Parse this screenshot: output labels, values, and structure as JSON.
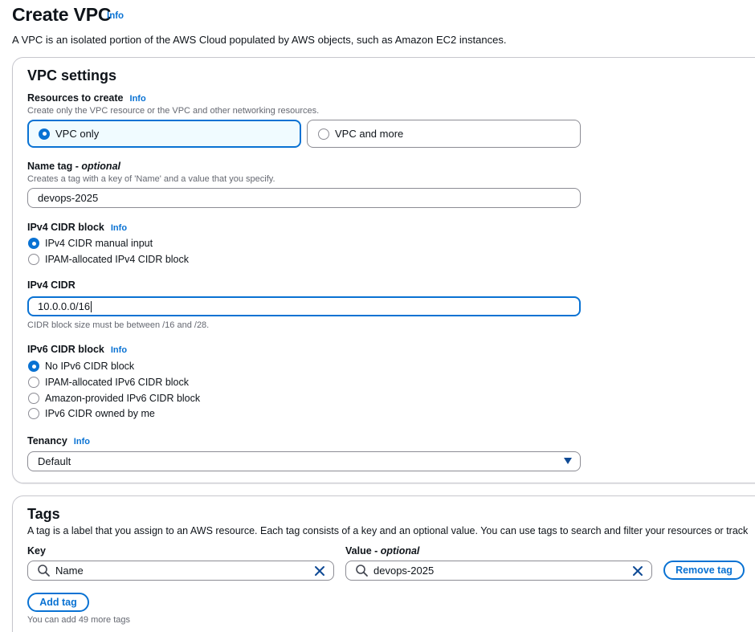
{
  "page": {
    "title": "Create VPC",
    "info": "Info",
    "description": "A VPC is an isolated portion of the AWS Cloud populated by AWS objects, such as Amazon EC2 instances."
  },
  "vpc_settings": {
    "heading": "VPC settings",
    "resources": {
      "label": "Resources to create",
      "info": "Info",
      "description": "Create only the VPC resource or the VPC and other networking resources.",
      "options": [
        {
          "label": "VPC only",
          "selected": true
        },
        {
          "label": "VPC and more",
          "selected": false
        }
      ]
    },
    "name_tag": {
      "label": "Name tag",
      "label_suffix": "optional",
      "description": "Creates a tag with a key of 'Name' and a value that you specify.",
      "value": "devops-2025"
    },
    "ipv4_block": {
      "label": "IPv4 CIDR block",
      "info": "Info",
      "options": [
        {
          "label": "IPv4 CIDR manual input",
          "selected": true
        },
        {
          "label": "IPAM-allocated IPv4 CIDR block",
          "selected": false
        }
      ]
    },
    "ipv4_cidr": {
      "label": "IPv4 CIDR",
      "value": "10.0.0.0/16",
      "hint": "CIDR block size must be between /16 and /28."
    },
    "ipv6_block": {
      "label": "IPv6 CIDR block",
      "info": "Info",
      "options": [
        {
          "label": "No IPv6 CIDR block",
          "selected": true
        },
        {
          "label": "IPAM-allocated IPv6 CIDR block",
          "selected": false
        },
        {
          "label": "Amazon-provided IPv6 CIDR block",
          "selected": false
        },
        {
          "label": "IPv6 CIDR owned by me",
          "selected": false
        }
      ]
    },
    "tenancy": {
      "label": "Tenancy",
      "info": "Info",
      "value": "Default"
    }
  },
  "tags": {
    "heading": "Tags",
    "description": "A tag is a label that you assign to an AWS resource. Each tag consists of a key and an optional value. You can use tags to search and filter your resources or track",
    "key_label": "Key",
    "value_label": "Value",
    "value_label_suffix": "optional",
    "rows": [
      {
        "key": "Name",
        "value": "devops-2025"
      }
    ],
    "remove_label": "Remove tag",
    "add_label": "Add tag",
    "limit_text": "You can add 49 more tags"
  },
  "colors": {
    "accent": "#0972d3",
    "text": "#0f141a",
    "muted": "#656871",
    "border": "#8c8c94"
  },
  "icons": {
    "search": "search-icon",
    "clear": "close-icon",
    "dropdown": "caret-down-icon"
  }
}
